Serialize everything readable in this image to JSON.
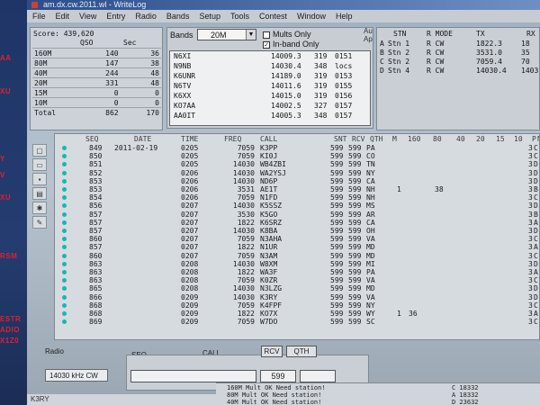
{
  "window": {
    "title": "am.dx.cw.2011.wl - WriteLog"
  },
  "menu": [
    "File",
    "Edit",
    "View",
    "Entry",
    "Radio",
    "Bands",
    "Setup",
    "Tools",
    "Contest",
    "Window",
    "Help"
  ],
  "left_strip": [
    "AA",
    "XU",
    "Y",
    "V",
    "XU",
    "RSM",
    "ESTR",
    "ADIO",
    "X1Z0"
  ],
  "score": {
    "score_label": "Score: 439,620",
    "col_qso": "QSO",
    "col_sec": "Sec",
    "rows": [
      {
        "band": "160M",
        "qso": "140",
        "sec": "36"
      },
      {
        "band": "80M",
        "qso": "147",
        "sec": "38"
      },
      {
        "band": "40M",
        "qso": "244",
        "sec": "48"
      },
      {
        "band": "20M",
        "qso": "331",
        "sec": "48"
      },
      {
        "band": "15M",
        "qso": "0",
        "sec": "0"
      },
      {
        "band": "10M",
        "qso": "0",
        "sec": "0"
      },
      {
        "band": "Total",
        "qso": "862",
        "sec": "170"
      }
    ]
  },
  "bands": {
    "label": "Bands",
    "selected": "20M",
    "mults_only": "Mults Only",
    "in_band_only": "In-band Only",
    "list": [
      {
        "call": "N6XI",
        "freq": "14009.3",
        "a": "319",
        "b": "0151"
      },
      {
        "call": "N9NB",
        "freq": "14030.4",
        "a": "348",
        "b": "locs"
      },
      {
        "call": "K6UNR",
        "freq": "14189.0",
        "a": "319",
        "b": "0153"
      },
      {
        "call": "N6TV",
        "freq": "14011.6",
        "a": "319",
        "b": "0155"
      },
      {
        "call": "K6XX",
        "freq": "14015.0",
        "a": "319",
        "b": "0156"
      },
      {
        "call": "KO7AA",
        "freq": "14002.5",
        "a": "327",
        "b": "0157"
      },
      {
        "call": "AA0IT",
        "freq": "14005.3",
        "a": "348",
        "b": "0157"
      }
    ]
  },
  "au_labels": [
    "Au",
    "Ap"
  ],
  "stations": {
    "headers": [
      "STN",
      "R MODE",
      "TX",
      "RX"
    ],
    "rows": [
      {
        "id": "A",
        "stn": "Stn 1",
        "mode": "R CW",
        "tx": "1822.3",
        "rx": "18"
      },
      {
        "id": "B",
        "stn": "Stn 2",
        "mode": "R CW",
        "tx": "3531.0",
        "rx": "35"
      },
      {
        "id": "C",
        "stn": "Stn 2",
        "mode": "R CW",
        "tx": "7059.4",
        "rx": "70"
      },
      {
        "id": "D",
        "stn": "Stn 4",
        "mode": "R CW",
        "tx": "14030.4",
        "rx": "1403"
      }
    ]
  },
  "log": {
    "headers": [
      "SEQ",
      "DATE",
      "TIME",
      "FREQ",
      "CALL",
      "SNT",
      "RCV",
      "QTH",
      "M",
      "160",
      "80",
      "40",
      "20",
      "15",
      "10",
      "P",
      "N"
    ],
    "rows": [
      {
        "seq": "849",
        "date": "2011-02-19",
        "time": "0205",
        "freq": "7059",
        "call": "K3PP",
        "snt": "599",
        "rcv": "599",
        "qth": "PA",
        "m": "",
        "c160": "",
        "c80": "",
        "p": "3",
        "n": "C"
      },
      {
        "seq": "850",
        "date": "",
        "time": "0205",
        "freq": "7059",
        "call": "KI0J",
        "snt": "599",
        "rcv": "599",
        "qth": "CO",
        "m": "",
        "c160": "",
        "c80": "",
        "p": "3",
        "n": "C"
      },
      {
        "seq": "851",
        "date": "",
        "time": "0205",
        "freq": "14030",
        "call": "WB4ZBI",
        "snt": "599",
        "rcv": "599",
        "qth": "TN",
        "m": "",
        "c160": "",
        "c80": "",
        "p": "3",
        "n": "D"
      },
      {
        "seq": "852",
        "date": "",
        "time": "0206",
        "freq": "14030",
        "call": "WA2YSJ",
        "snt": "599",
        "rcv": "599",
        "qth": "NY",
        "m": "",
        "c160": "",
        "c80": "",
        "p": "3",
        "n": "D"
      },
      {
        "seq": "853",
        "date": "",
        "time": "0206",
        "freq": "14030",
        "call": "ND6P",
        "snt": "599",
        "rcv": "599",
        "qth": "CA",
        "m": "",
        "c160": "",
        "c80": "",
        "p": "3",
        "n": "D"
      },
      {
        "seq": "853",
        "date": "",
        "time": "0206",
        "freq": "3531",
        "call": "AE1T",
        "snt": "599",
        "rcv": "599",
        "qth": "NH",
        "m": "1",
        "c160": "",
        "c80": "38",
        "p": "3",
        "n": "B"
      },
      {
        "seq": "854",
        "date": "",
        "time": "0206",
        "freq": "7059",
        "call": "N1FD",
        "snt": "599",
        "rcv": "599",
        "qth": "NH",
        "m": "",
        "c160": "",
        "c80": "",
        "p": "3",
        "n": "C"
      },
      {
        "seq": "856",
        "date": "",
        "time": "0207",
        "freq": "14030",
        "call": "K5SSZ",
        "snt": "599",
        "rcv": "599",
        "qth": "MS",
        "m": "",
        "c160": "",
        "c80": "",
        "p": "3",
        "n": "D"
      },
      {
        "seq": "857",
        "date": "",
        "time": "0207",
        "freq": "3530",
        "call": "K5GO",
        "snt": "599",
        "rcv": "599",
        "qth": "AR",
        "m": "",
        "c160": "",
        "c80": "",
        "p": "3",
        "n": "B"
      },
      {
        "seq": "857",
        "date": "",
        "time": "0207",
        "freq": "1822",
        "call": "K6SRZ",
        "snt": "599",
        "rcv": "599",
        "qth": "CA",
        "m": "",
        "c160": "",
        "c80": "",
        "p": "3",
        "n": "A"
      },
      {
        "seq": "857",
        "date": "",
        "time": "0207",
        "freq": "14030",
        "call": "K8BA",
        "snt": "599",
        "rcv": "599",
        "qth": "OH",
        "m": "",
        "c160": "",
        "c80": "",
        "p": "3",
        "n": "D"
      },
      {
        "seq": "860",
        "date": "",
        "time": "0207",
        "freq": "7059",
        "call": "N3AHA",
        "snt": "599",
        "rcv": "599",
        "qth": "VA",
        "m": "",
        "c160": "",
        "c80": "",
        "p": "3",
        "n": "C"
      },
      {
        "seq": "857",
        "date": "",
        "time": "0207",
        "freq": "1822",
        "call": "N1UR",
        "snt": "599",
        "rcv": "599",
        "qth": "MD",
        "m": "",
        "c160": "",
        "c80": "",
        "p": "3",
        "n": "A"
      },
      {
        "seq": "860",
        "date": "",
        "time": "0207",
        "freq": "7059",
        "call": "N3AM",
        "snt": "599",
        "rcv": "599",
        "qth": "MD",
        "m": "",
        "c160": "",
        "c80": "",
        "p": "3",
        "n": "C"
      },
      {
        "seq": "863",
        "date": "",
        "time": "0208",
        "freq": "14030",
        "call": "W8XM",
        "snt": "599",
        "rcv": "599",
        "qth": "MI",
        "m": "",
        "c160": "",
        "c80": "",
        "p": "3",
        "n": "D"
      },
      {
        "seq": "863",
        "date": "",
        "time": "0208",
        "freq": "1822",
        "call": "WA3F",
        "snt": "599",
        "rcv": "599",
        "qth": "PA",
        "m": "",
        "c160": "",
        "c80": "",
        "p": "3",
        "n": "A"
      },
      {
        "seq": "863",
        "date": "",
        "time": "0208",
        "freq": "7059",
        "call": "K0ZR",
        "snt": "599",
        "rcv": "599",
        "qth": "VA",
        "m": "",
        "c160": "",
        "c80": "",
        "p": "3",
        "n": "C"
      },
      {
        "seq": "865",
        "date": "",
        "time": "0208",
        "freq": "14030",
        "call": "N3LZG",
        "snt": "599",
        "rcv": "599",
        "qth": "MD",
        "m": "",
        "c160": "",
        "c80": "",
        "p": "3",
        "n": "D"
      },
      {
        "seq": "866",
        "date": "",
        "time": "0209",
        "freq": "14030",
        "call": "K3RY",
        "snt": "599",
        "rcv": "599",
        "qth": "VA",
        "m": "",
        "c160": "",
        "c80": "",
        "p": "3",
        "n": "D"
      },
      {
        "seq": "868",
        "date": "",
        "time": "0209",
        "freq": "7059",
        "call": "K4FPF",
        "snt": "599",
        "rcv": "599",
        "qth": "NY",
        "m": "",
        "c160": "",
        "c80": "",
        "p": "3",
        "n": "C"
      },
      {
        "seq": "868",
        "date": "",
        "time": "0209",
        "freq": "1822",
        "call": "KO7X",
        "snt": "599",
        "rcv": "599",
        "qth": "WY",
        "m": "1",
        "c160": "36",
        "c80": "",
        "p": "3",
        "n": "A"
      },
      {
        "seq": "869",
        "date": "",
        "time": "0209",
        "freq": "7059",
        "call": "W7DO",
        "snt": "599",
        "rcv": "599",
        "qth": "SC",
        "m": "",
        "c160": "",
        "c80": "",
        "p": "3",
        "n": "C"
      }
    ]
  },
  "radio": {
    "label": "Radio",
    "freq": "14030 kHz CW",
    "seq_label": "SEQ",
    "call_label": "CALL",
    "rcv_label": "RCV",
    "qth_label": "QTH",
    "rcv_value": "599"
  },
  "status_lines": [
    "160M Mult OK    Need station!",
    "80M  Mult OK    Need station!",
    "40M  Mult OK    Need station!"
  ],
  "status_freqs": [
    "C  18332",
    "A  18332",
    "D  23632"
  ],
  "bottom_left": "K3RY"
}
